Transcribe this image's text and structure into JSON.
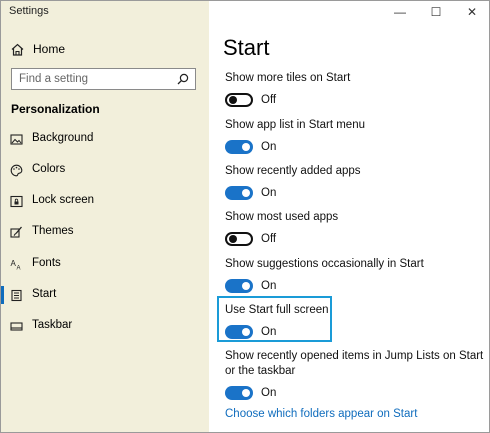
{
  "window": {
    "title": "Settings",
    "controls": {
      "minimize": "—",
      "maximize": "☐",
      "close": "✕"
    }
  },
  "sidebar": {
    "home": {
      "label": "Home",
      "icon": "home-icon"
    },
    "search": {
      "placeholder": "Find a setting",
      "icon": "search-icon"
    },
    "section_title": "Personalization",
    "items": [
      {
        "label": "Background",
        "icon": "image-icon"
      },
      {
        "label": "Colors",
        "icon": "palette-icon"
      },
      {
        "label": "Lock screen",
        "icon": "lock-screen-icon"
      },
      {
        "label": "Themes",
        "icon": "brush-icon"
      },
      {
        "label": "Fonts",
        "icon": "font-icon"
      },
      {
        "label": "Start",
        "icon": "start-icon",
        "active": true
      },
      {
        "label": "Taskbar",
        "icon": "taskbar-icon"
      }
    ]
  },
  "main": {
    "title": "Start",
    "settings": [
      {
        "label": "Show more tiles on Start",
        "state": "Off",
        "on": false
      },
      {
        "label": "Show app list in Start menu",
        "state": "On",
        "on": true
      },
      {
        "label": "Show recently added apps",
        "state": "On",
        "on": true
      },
      {
        "label": "Show most used apps",
        "state": "Off",
        "on": false
      },
      {
        "label": "Show suggestions occasionally in Start",
        "state": "On",
        "on": true
      },
      {
        "label": "Use Start full screen",
        "state": "On",
        "on": true
      },
      {
        "label": "Show recently opened items in Jump Lists on Start or the taskbar",
        "state": "On",
        "on": true
      }
    ],
    "link": "Choose which folders appear on Start"
  },
  "colors": {
    "sidebar_bg": "#f2efdb",
    "accent": "#1a73c8",
    "highlight_border": "#1a9bd7",
    "link": "#0f6cbd"
  }
}
